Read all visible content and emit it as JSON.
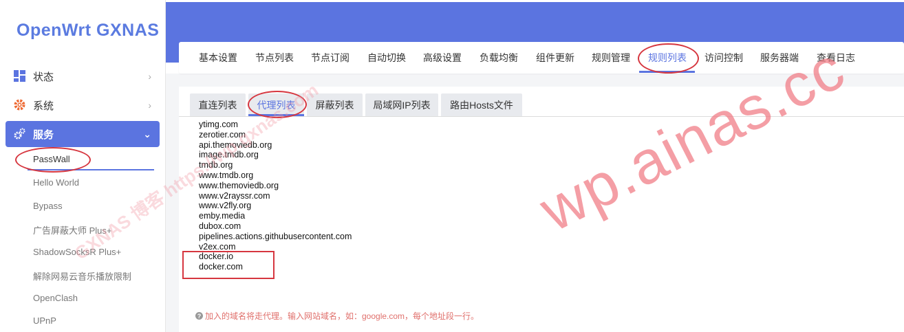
{
  "sidebar": {
    "logo": "OpenWrt GXNAS",
    "items": [
      {
        "label": "状态",
        "icon": "dashboard-icon"
      },
      {
        "label": "系统",
        "icon": "gear-icon"
      },
      {
        "label": "服务",
        "icon": "gears-icon"
      }
    ],
    "sub_items": [
      "PassWall",
      "Hello World",
      "Bypass",
      "广告屏蔽大师 Plus+",
      "ShadowSocksR Plus+",
      "解除网易云音乐播放限制",
      "OpenClash",
      "UPnP"
    ]
  },
  "main_tabs": [
    "基本设置",
    "节点列表",
    "节点订阅",
    "自动切换",
    "高级设置",
    "负载均衡",
    "组件更新",
    "规则管理",
    "规则列表",
    "访问控制",
    "服务器端",
    "查看日志"
  ],
  "active_main_tab": "规则列表",
  "sub_tabs": [
    "直连列表",
    "代理列表",
    "屏蔽列表",
    "局域网IP列表",
    "路由Hosts文件"
  ],
  "active_sub_tab": "代理列表",
  "proxy_list": {
    "domains": [
      "ytimg.com",
      "zerotier.com",
      "api.themoviedb.org",
      "image.tmdb.org",
      "tmdb.org",
      "www.tmdb.org",
      "www.themoviedb.org",
      "www.v2rayssr.com",
      "www.v2fly.org",
      "emby.media",
      "dubox.com",
      "pipelines.actions.githubusercontent.com",
      "v2ex.com",
      "docker.io",
      "docker.com"
    ],
    "hint": "加入的域名将走代理。输入网站域名，如：google.com，每个地址段一行。"
  },
  "watermark": {
    "big": "wp.ainas.cc",
    "small": "GXNAS 博客 https://wp.gxnas.com"
  },
  "colors": {
    "accent": "#5b74e0",
    "annotation": "#d6363f",
    "hint": "#e0706c"
  }
}
